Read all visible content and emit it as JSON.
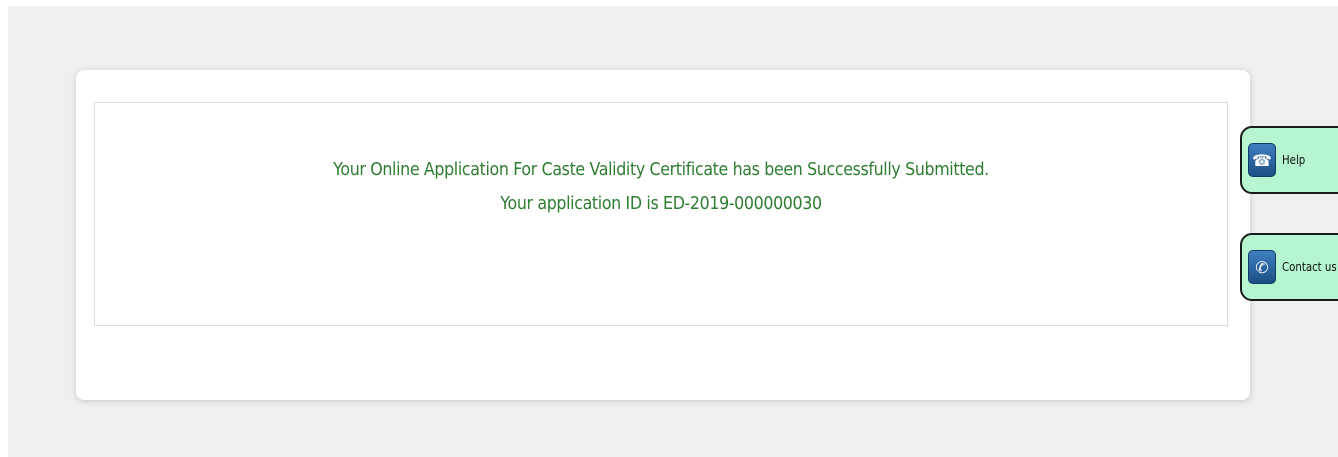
{
  "message": {
    "line1": "Your Online Application For Caste Validity Certificate has been Successfully Submitted.",
    "line2": "Your application ID is ED-2019-000000030",
    "color": "#2e7d32"
  },
  "side_tabs": {
    "help": {
      "label": "Help",
      "icon": "help-desk-icon"
    },
    "contact": {
      "label": "Contact us",
      "icon": "phone-icon"
    },
    "background_color": "#b5f5cf"
  }
}
